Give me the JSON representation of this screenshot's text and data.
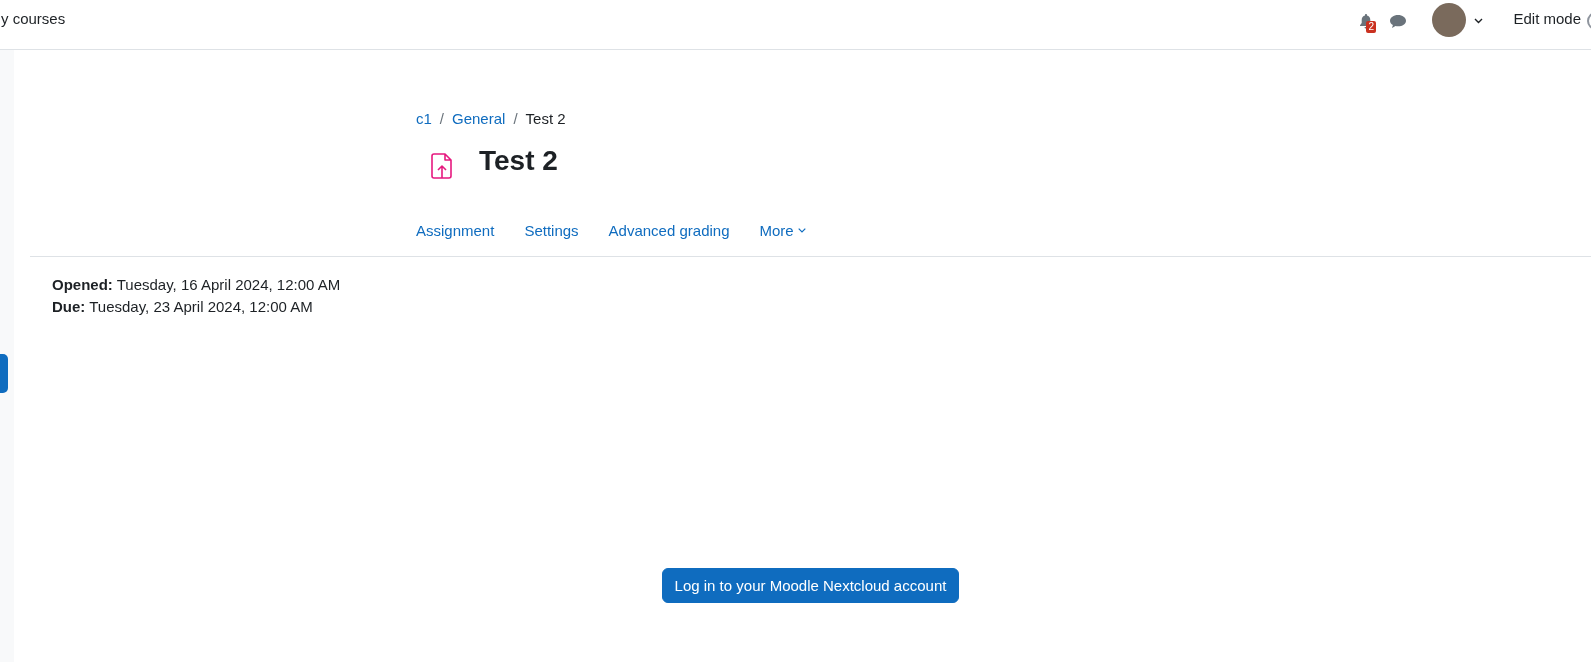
{
  "navbar": {
    "link": "y courses",
    "notification_count": "2",
    "edit_mode_label": "Edit mode"
  },
  "breadcrumb": {
    "separator": "/",
    "items": [
      {
        "label": "c1",
        "kind": "link"
      },
      {
        "label": "General",
        "kind": "link"
      },
      {
        "label": "Test 2",
        "kind": "current"
      }
    ]
  },
  "heading": "Test 2",
  "tabs": [
    {
      "label": "Assignment",
      "kind": "link"
    },
    {
      "label": "Settings",
      "kind": "link"
    },
    {
      "label": "Advanced grading",
      "kind": "link"
    },
    {
      "label": "More",
      "kind": "dropdown"
    }
  ],
  "dates": [
    "**Opened:** Tuesday, 16 April 2024, 12:00 AM",
    "**Due:** Tuesday, 23 April 2024, 12:00 AM"
  ],
  "login_button": "Log in to your Moodle Nextcloud account"
}
